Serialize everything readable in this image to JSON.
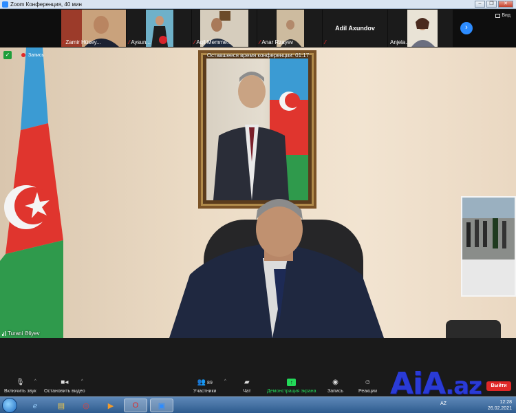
{
  "window": {
    "title": "Zoom Конференция, 40 мин",
    "buttons": [
      "–",
      "❐",
      "✕"
    ]
  },
  "gallery": {
    "participants": [
      {
        "name": "Zamir Hüsey..."
      },
      {
        "name": "Aysun..."
      },
      {
        "name": "Aqil Memme..."
      },
      {
        "name": "Anar Rzayev"
      },
      {
        "name": "Adil Axundov"
      },
      {
        "name": "Anjela..."
      }
    ],
    "next_label": "›",
    "view_label": "Вид"
  },
  "main_video": {
    "timer": "Оставшееся время конференции: 01:17",
    "recording_label": "Запись",
    "active_speaker": "Turani Əliyev"
  },
  "toolbar": {
    "audio_label": "Включить звук",
    "video_label": "Остановить видео",
    "participants_label": "Участники",
    "participants_count": "89",
    "chat_label": "Чат",
    "share_label": "Демонстрация экрана",
    "record_label": "Запись",
    "reactions_label": "Реакции",
    "leave_label": "Выйти"
  },
  "logo": {
    "text_main": "AiA",
    "text_suffix": ".az"
  },
  "taskbar": {
    "language": "AZ",
    "time": "12:28",
    "date": "26.02.2021"
  },
  "colors": {
    "zoom_blue": "#2d8cff",
    "share_green": "#23d959",
    "leave_red": "#e02828",
    "logo_blue": "#2a3bd6"
  }
}
